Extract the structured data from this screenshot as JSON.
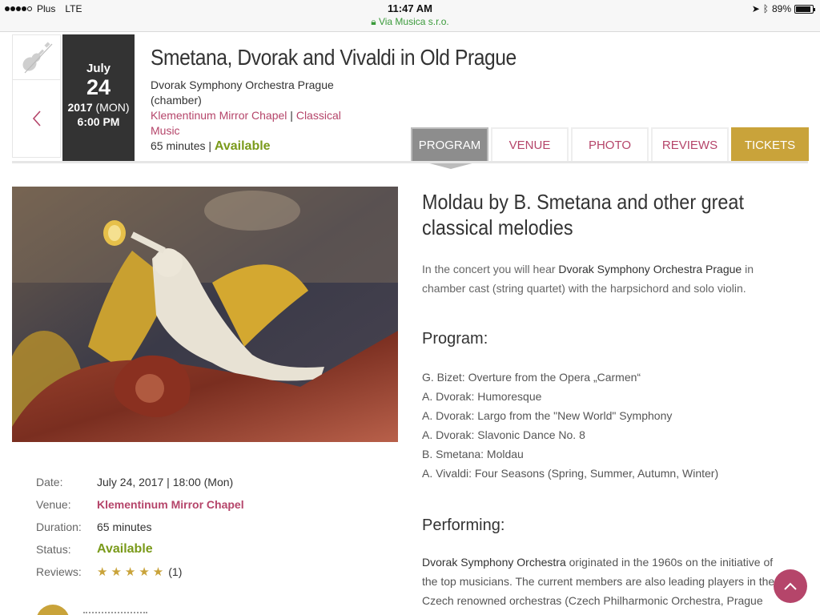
{
  "status_bar": {
    "carrier": "Plus",
    "network": "LTE",
    "time": "11:47 AM",
    "site": "Via Musica s.r.o.",
    "battery": "89%",
    "battery_level": 0.89
  },
  "header": {
    "date": {
      "month": "July",
      "day": "24",
      "year": "2017",
      "dow": "(MON)",
      "time": "6:00 PM"
    },
    "title": "Smetana, Dvorak and Vivaldi in Old Prague",
    "orchestra": "Dvorak Symphony Orchestra Prague (chamber)",
    "venue_link": "Klementinum Mirror Chapel",
    "separator": "|",
    "category_link": "Classical Music",
    "duration": "65 minutes",
    "availability": "Available"
  },
  "tabs": [
    {
      "label": "PROGRAM",
      "active": true
    },
    {
      "label": "VENUE"
    },
    {
      "label": "PHOTO"
    },
    {
      "label": "REVIEWS"
    },
    {
      "label": "TICKETS"
    }
  ],
  "details": {
    "date_label": "Date:",
    "date_value": "July 24, 2017 | 18:00 (Mon)",
    "venue_label": "Venue:",
    "venue_value": "Klementinum Mirror Chapel",
    "duration_label": "Duration:",
    "duration_value": "65 minutes",
    "status_label": "Status:",
    "status_value": "Available",
    "reviews_label": "Reviews:",
    "reviews_stars": "★★★★★",
    "reviews_count": "(1)"
  },
  "content": {
    "heading": "Moldau by B. Smetana and other great classical melodies",
    "intro_pre": "In the concert you will hear ",
    "intro_bold": "Dvorak Symphony Orchestra Prague",
    "intro_post": " in chamber cast (string quartet) with the harpsichord and solo violin.",
    "program_heading": "Program:",
    "program": [
      "G. Bizet: Overture from the Opera „Carmen“",
      "A. Dvorak: Humoresque",
      "A. Dvorak: Largo from the \"New World\" Symphony",
      "A. Dvorak: Slavonic Dance No. 8",
      "B. Smetana: Moldau",
      "A. Vivaldi: Four Seasons (Spring, Summer, Autumn, Winter)"
    ],
    "performing_heading": "Performing:",
    "performing_bold": "Dvorak Symphony Orchestra",
    "performing_text": " originated in the 1960s on the initiative of the top musicians. The current members are also leading players in the Czech renowned orchestras (Czech Philharmonic Orchestra, Prague Symphony Orchestra, Orchestra of The National Theatre and others). The"
  },
  "icons": {
    "violin": "violin-icon",
    "back": "chevron-left-icon",
    "scroll_top": "chevron-up-icon",
    "lock": "lock-icon"
  },
  "colors": {
    "accent_pink": "#b5456a",
    "available_green": "#7a9a1a",
    "tickets_gold": "#c9a33a",
    "date_box": "#333333",
    "active_tab": "#8d8d8d"
  }
}
